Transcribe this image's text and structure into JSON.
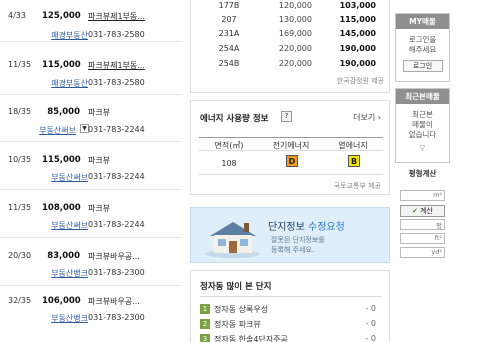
{
  "listings": [
    {
      "ratio": "4/33",
      "price": "125,000",
      "complex": "파크뷰제1부동...",
      "complex_link": true,
      "agent": "매경부동산",
      "phone": "031-783-2580",
      "dropdown": false
    },
    {
      "ratio": "11/35",
      "price": "115,000",
      "complex": "파크뷰제1부동...",
      "complex_link": true,
      "agent": "매경부동산",
      "phone": "031-783-2580",
      "dropdown": false
    },
    {
      "ratio": "18/35",
      "price": "85,000",
      "complex": "파크뷰",
      "complex_link": false,
      "agent": "부동산써브",
      "phone": "031-783-2244",
      "dropdown": true
    },
    {
      "ratio": "10/35",
      "price": "115,000",
      "complex": "파크뷰",
      "complex_link": false,
      "agent": "부동산써브",
      "phone": "031-783-2244",
      "dropdown": false
    },
    {
      "ratio": "11/35",
      "price": "108,000",
      "complex": "파크뷰",
      "complex_link": false,
      "agent": "부동산써브",
      "phone": "031-783-2244",
      "dropdown": false
    },
    {
      "ratio": "20/30",
      "price": "83,000",
      "complex": "파크뷰바우공...",
      "complex_link": false,
      "agent": "부동산뱅크",
      "phone": "031-783-2300",
      "dropdown": false
    },
    {
      "ratio": "32/35",
      "price": "106,000",
      "complex": "파크뷰바우공...",
      "complex_link": false,
      "agent": "부동산뱅크",
      "phone": "031-783-2300",
      "dropdown": false
    }
  ],
  "price_table": {
    "rows": [
      {
        "type": "177B",
        "low": "120,000",
        "high": "103,000"
      },
      {
        "type": "207",
        "low": "130,000",
        "high": "115,000"
      },
      {
        "type": "231A",
        "low": "169,000",
        "high": "145,000"
      },
      {
        "type": "254A",
        "low": "220,000",
        "high": "190,000"
      },
      {
        "type": "254B",
        "low": "220,000",
        "high": "190,000"
      }
    ],
    "source": "한국감정원 제공"
  },
  "energy": {
    "title": "에너지 사용량 정보",
    "help_icon": "?",
    "more": "더보기",
    "more_icon": "›",
    "headers": [
      "면적(㎡)",
      "전기에너지",
      "열에너지"
    ],
    "row": {
      "area": "108",
      "electric": "D",
      "heat": "B"
    },
    "colors": {
      "D": "#f39b1e",
      "B": "#f2e10a"
    },
    "source": "국토교통부 제공"
  },
  "banner": {
    "title": "단지정보",
    "title_highlight": "수정요청",
    "desc_line1": "잘못된 단지정보를",
    "desc_line2": "등록해 주세요."
  },
  "most_viewed": {
    "title": "정자동 많이 본 단지",
    "items": [
      {
        "rank": "1",
        "name": "정자동 상록우성",
        "count": "0"
      },
      {
        "rank": "2",
        "name": "정자동 파크뷰",
        "count": "0"
      },
      {
        "rank": "3",
        "name": "정자동 한솔4단지주공",
        "count": "0"
      }
    ]
  },
  "sidebar": {
    "my_title": "MY매물",
    "my_text1": "로그인을",
    "my_text2": "해주세요",
    "login": "로그인",
    "recent_title": "최근본매물",
    "recent_text1": "최근본",
    "recent_text2": "매물이",
    "recent_text3": "없습니다",
    "recent_arrow": "▽",
    "calc_title": "평형계산",
    "unit_m2": "m²",
    "unit_py": "평",
    "unit_ft": "ft²",
    "unit_yd": "yd²",
    "calc_button": "계산",
    "check_icon": "✔"
  },
  "colors": {
    "link_blue": "#2c5aa0",
    "banner_bg": "#dfeef9",
    "rank_green": "#7aa344",
    "side_header": "#8f8f8f"
  }
}
